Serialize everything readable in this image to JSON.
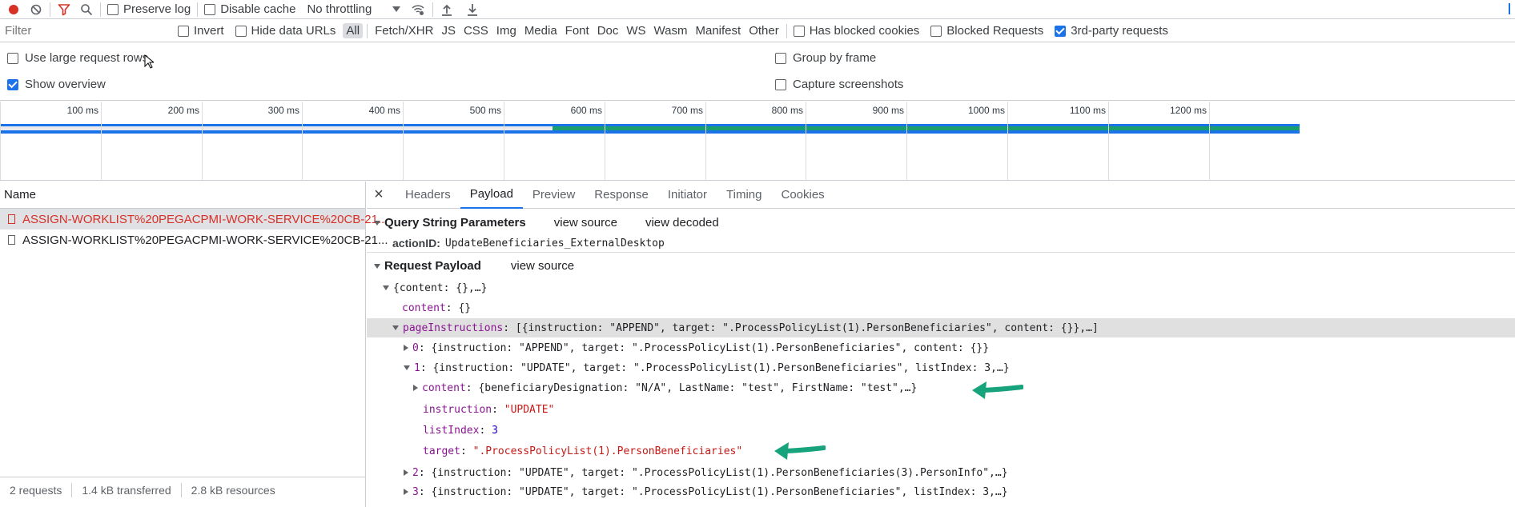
{
  "toolbar": {
    "preserve_log": "Preserve log",
    "disable_cache": "Disable cache",
    "throttling": "No throttling"
  },
  "filterbar": {
    "filter_placeholder": "Filter",
    "invert": "Invert",
    "hide_data_urls": "Hide data URLs",
    "types": [
      "All",
      "Fetch/XHR",
      "JS",
      "CSS",
      "Img",
      "Media",
      "Font",
      "Doc",
      "WS",
      "Wasm",
      "Manifest",
      "Other"
    ],
    "has_blocked_cookies": "Has blocked cookies",
    "blocked_requests": "Blocked Requests",
    "third_party": "3rd-party requests",
    "third_party_checked": true
  },
  "settings": {
    "large_rows": "Use large request rows",
    "show_overview": "Show overview",
    "group_by_frame": "Group by frame",
    "capture_screenshots": "Capture screenshots"
  },
  "timeline": {
    "ticks": [
      "100 ms",
      "200 ms",
      "300 ms",
      "400 ms",
      "500 ms",
      "600 ms",
      "700 ms",
      "800 ms",
      "900 ms",
      "1000 ms",
      "1100 ms",
      "1200 ms"
    ]
  },
  "requests": {
    "header": "Name",
    "items": [
      "ASSIGN-WORKLIST%20PEGACPMI-WORK-SERVICE%20CB-21...",
      "ASSIGN-WORKLIST%20PEGACPMI-WORK-SERVICE%20CB-21..."
    ]
  },
  "statusbar": {
    "requests": "2 requests",
    "transferred": "1.4 kB transferred",
    "resources": "2.8 kB resources"
  },
  "detail": {
    "close": "×",
    "tabs": [
      "Headers",
      "Payload",
      "Preview",
      "Response",
      "Initiator",
      "Timing",
      "Cookies"
    ],
    "active_tab": "Payload",
    "query_title": "Query String Parameters",
    "view_source": "view source",
    "view_decoded": "view decoded",
    "action_key": "actionID:",
    "action_value": "UpdateBeneficiaries_ExternalDesktop",
    "payload_title": "Request Payload",
    "payload_view_source": "view source",
    "tree": {
      "root": "{content: {},…}",
      "content_key": "content",
      "content_val": "{}",
      "pi_key": "pageInstructions",
      "pi_val": "[{instruction: \"APPEND\", target: \".ProcessPolicyList(1).PersonBeneficiaries\", content: {}},…]",
      "i0_key": "0",
      "i0_val": "{instruction: \"APPEND\", target: \".ProcessPolicyList(1).PersonBeneficiaries\", content: {}}",
      "i1_key": "1",
      "i1_val": "{instruction: \"UPDATE\", target: \".ProcessPolicyList(1).PersonBeneficiaries\", listIndex: 3,…}",
      "c_key": "content",
      "c_val": "{beneficiaryDesignation: \"N/A\", LastName: \"test\", FirstName: \"test\",…}",
      "ins_key": "instruction",
      "ins_val": "\"UPDATE\"",
      "li_key": "listIndex",
      "li_val": "3",
      "tg_key": "target",
      "tg_val": "\".ProcessPolicyList(1).PersonBeneficiaries\"",
      "i2_key": "2",
      "i2_val": "{instruction: \"UPDATE\", target: \".ProcessPolicyList(1).PersonBeneficiaries(3).PersonInfo\",…}",
      "i3_key": "3",
      "i3_val": "{instruction: \"UPDATE\", target: \".ProcessPolicyList(1).PersonBeneficiaries\", listIndex: 3,…}"
    }
  },
  "colors": {
    "accent": "#1a73e8",
    "record_red": "#d93025",
    "error_text": "#d93025",
    "arrow_green": "#17a37c",
    "bar_green": "#1a9e6e"
  }
}
